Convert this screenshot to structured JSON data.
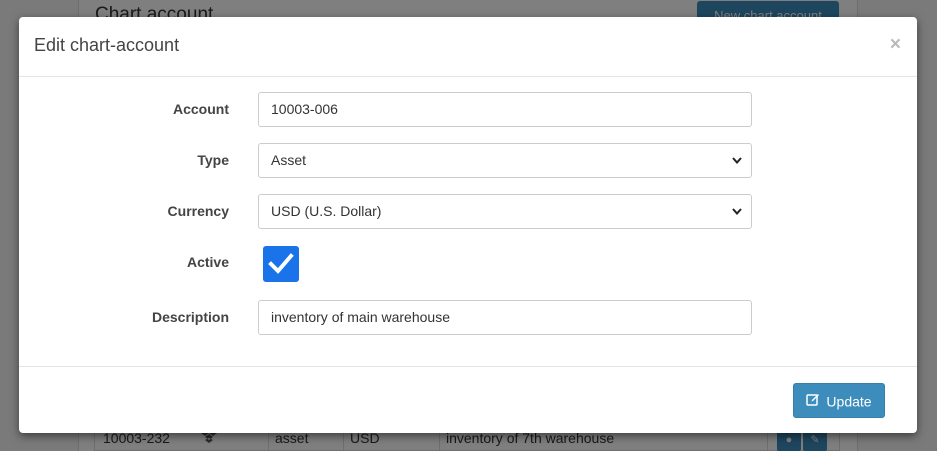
{
  "background": {
    "title": "Chart account",
    "new_button": "New chart account",
    "row": {
      "account": "10003-232",
      "type": "asset",
      "currency": "USD",
      "description": "inventory of 7th warehouse"
    }
  },
  "modal": {
    "title": "Edit chart-account",
    "close": "×",
    "fields": {
      "account": {
        "label": "Account",
        "value": "10003-006"
      },
      "type": {
        "label": "Type",
        "value": "Asset"
      },
      "currency": {
        "label": "Currency",
        "value": "USD (U.S. Dollar)"
      },
      "active": {
        "label": "Active",
        "checked": true
      },
      "description": {
        "label": "Description",
        "value": "inventory of main warehouse"
      }
    },
    "update_button": "Update"
  },
  "colors": {
    "primary": "#3c8dbc",
    "checkbox": "#1a73e8"
  }
}
